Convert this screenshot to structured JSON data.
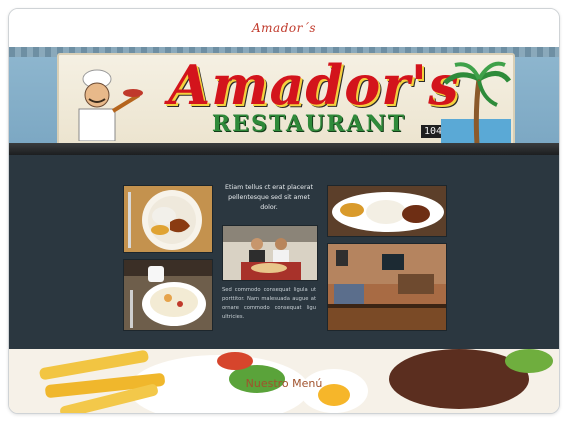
{
  "header": {
    "title": "Amador´s"
  },
  "hero": {
    "sign_name": "Amador's",
    "sign_subtitle": "RESTAURANT",
    "sign_number": "104"
  },
  "gallery": {
    "intro_text": "Etiam tellus ct erat placerat pellentesque sed sit amet dolor.",
    "body_text": "Sed commodo consequat ligula ut porttitor. Nam malesuada augue at ornare commodo consequat ligu ultricies."
  },
  "menu": {
    "title": "Nuestro Menú"
  },
  "colors": {
    "title_red": "#c0392b",
    "gallery_bg": "#2b3740",
    "menu_title": "#a0522d"
  }
}
